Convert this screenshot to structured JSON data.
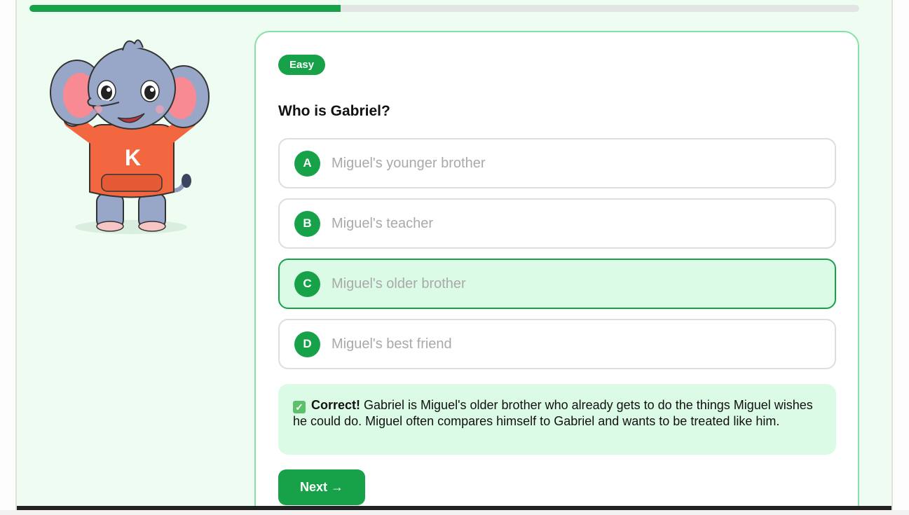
{
  "progress": {
    "fraction": 0.375
  },
  "colors": {
    "accent": "#17a24a",
    "page_bg": "#effcf2",
    "correct_bg": "#dcfbe6",
    "card_border": "#86e2a4"
  },
  "mascot": {
    "icon": "elephant-mascot-icon",
    "shirt_letter": "K"
  },
  "quiz": {
    "difficulty": "Easy",
    "question": "Who is Gabriel?",
    "options": [
      {
        "letter": "A",
        "text": "Miguel's younger brother",
        "state": "default"
      },
      {
        "letter": "B",
        "text": "Miguel's teacher",
        "state": "default"
      },
      {
        "letter": "C",
        "text": "Miguel's older brother",
        "state": "correct"
      },
      {
        "letter": "D",
        "text": "Miguel's best friend",
        "state": "default"
      }
    ],
    "feedback": {
      "icon": "check-mark-icon",
      "label": "Correct!",
      "text": "Gabriel is Miguel's older brother who already gets to do the things Miguel wishes he could do. Miguel often compares himself to Gabriel and wants to be treated like him."
    },
    "next_label": "Next →"
  }
}
